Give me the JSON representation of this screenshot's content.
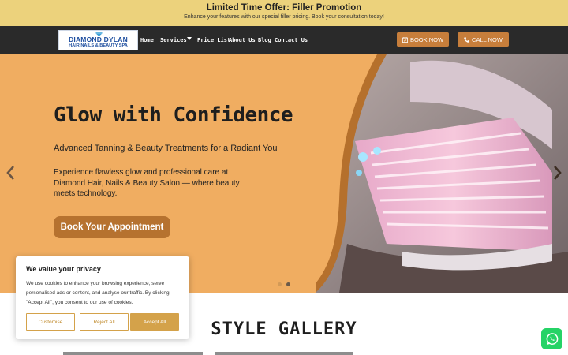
{
  "promo": {
    "title": "Limited Time Offer: Filler Promotion",
    "subtitle": "Enhance your features with our special filler pricing. Book your consultation today!"
  },
  "logo": {
    "line1": "DIAMOND DYLAN",
    "line2": "HAIR NAILS & BEAUTY SPA"
  },
  "nav": {
    "items": [
      "Home",
      "Services",
      "Price List",
      "About Us",
      "Blog",
      "Contact Us"
    ],
    "book_label": "BOOK NOW",
    "call_label": "CALL NOW"
  },
  "hero": {
    "title": "Glow with Confidence",
    "subtitle": "Advanced Tanning & Beauty Treatments for a Radiant You",
    "body": "Experience flawless glow and professional care at Diamond Hair, Nails & Beauty Salon — where beauty meets technology.",
    "cta": "Book Your Appointment",
    "slide_count": 2,
    "active_slide": 2
  },
  "gallery": {
    "title": "STYLE GALLERY"
  },
  "cookie": {
    "title": "We value your privacy",
    "text": "We use cookies to enhance your browsing experience, serve personalised ads or content, and analyse our traffic. By clicking \"Accept All\", you consent to our use of cookies.",
    "customise": "Customise",
    "reject": "Reject All",
    "accept": "Accept All"
  },
  "colors": {
    "promo_bg": "#ecd27c",
    "nav_bg": "#2a2a2a",
    "accent": "#c77e3b",
    "hero_bg": "#f0ad61",
    "cookie_accent": "#d4a24a",
    "whatsapp": "#25d366"
  },
  "icons": [
    "diamond-icon",
    "calendar-icon",
    "phone-icon",
    "chevron-down-icon",
    "chevron-left-icon",
    "chevron-right-icon",
    "whatsapp-icon"
  ]
}
